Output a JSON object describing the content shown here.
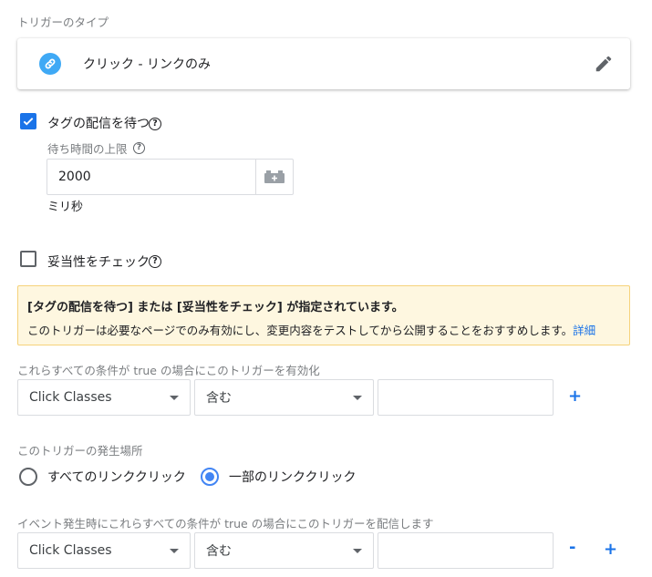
{
  "trigger_type": {
    "section_label": "トリガーのタイプ",
    "name": "クリック - リンクのみ"
  },
  "wait_for_tags": {
    "label": "タグの配信を待つ",
    "checked": true,
    "max_wait_label": "待ち時間の上限",
    "value": "2000",
    "unit": "ミリ秒"
  },
  "check_validation": {
    "label": "妥当性をチェック",
    "checked": false
  },
  "warning": {
    "title": "[タグの配信を待つ] または [妥当性をチェック] が指定されています。",
    "body": "このトリガーは必要なページでのみ有効にし、変更内容をテストしてから公開することをおすすめします。",
    "link": "詳細"
  },
  "enable_conditions": {
    "label": "これらすべての条件が true の場合にこのトリガーを有効化",
    "variable": "Click Classes",
    "operator": "含む",
    "value": "",
    "add": "+"
  },
  "fires_on": {
    "label": "このトリガーの発生場所",
    "options": [
      "すべてのリンククリック",
      "一部のリンククリック"
    ],
    "selected": 1
  },
  "fire_conditions": {
    "label": "イベント発生時にこれらすべての条件が true の場合にこのトリガーを配信します",
    "variable": "Click Classes",
    "operator": "含む",
    "value": "",
    "remove": "-",
    "add": "+"
  },
  "help_glyph": "?",
  "colors": {
    "accent": "#1a73e8",
    "link_icon": "#3fa9f5",
    "warning_bg": "#fef7e0",
    "warning_border": "#f6d27a"
  }
}
